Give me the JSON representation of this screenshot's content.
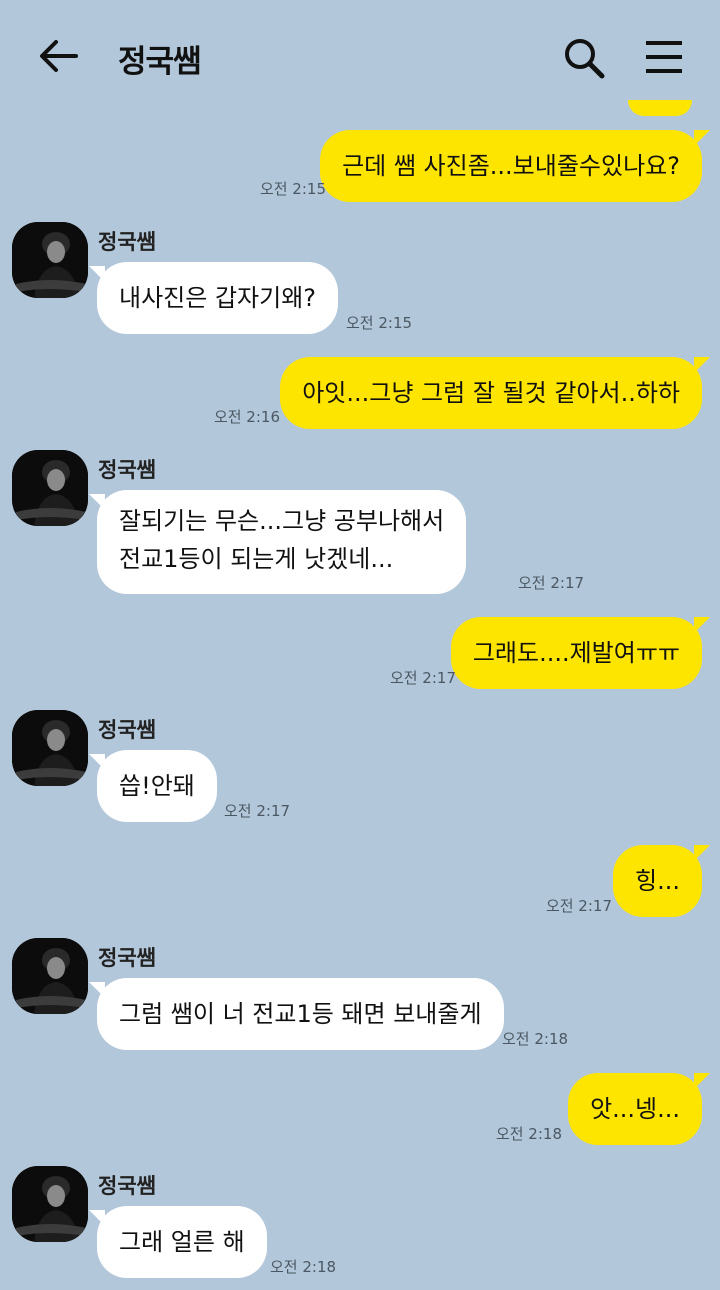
{
  "header": {
    "title": "정국쌤",
    "back_icon": "back-arrow-icon",
    "search_icon": "search-icon",
    "menu_icon": "hamburger-menu-icon"
  },
  "colors": {
    "background": "#b2c7da",
    "my_bubble": "#fee500",
    "their_bubble": "#ffffff"
  },
  "messages": [
    {
      "from": "me",
      "text": "근데 쌤 사진좀...보내줄수있나요?",
      "time": "오전 2:15"
    },
    {
      "from": "them",
      "sender": "정국쌤",
      "text": "내사진은 갑자기왜?",
      "time": "오전 2:15"
    },
    {
      "from": "me",
      "text": "아잇...그냥 그럼 잘 될것 같아서..하하",
      "time": "오전 2:16"
    },
    {
      "from": "them",
      "sender": "정국쌤",
      "lines": [
        "잘되기는 무슨...그냥 공부나해서",
        "전교1등이 되는게 낫겠네..."
      ],
      "time": "오전 2:17"
    },
    {
      "from": "me",
      "text": "그래도....제발여ㅠㅠ",
      "time": "오전 2:17"
    },
    {
      "from": "them",
      "sender": "정국쌤",
      "text": "씁!안돼",
      "time": "오전 2:17"
    },
    {
      "from": "me",
      "text": "힝...",
      "time": "오전 2:17"
    },
    {
      "from": "them",
      "sender": "정국쌤",
      "text": "그럼 쌤이 너 전교1등 돼면 보내줄게",
      "time": "오전 2:18"
    },
    {
      "from": "me",
      "text": "앗...넹...",
      "time": "오전 2:18"
    },
    {
      "from": "them",
      "sender": "정국쌤",
      "text": "그래 얼른 해",
      "time": "오전 2:18"
    }
  ]
}
